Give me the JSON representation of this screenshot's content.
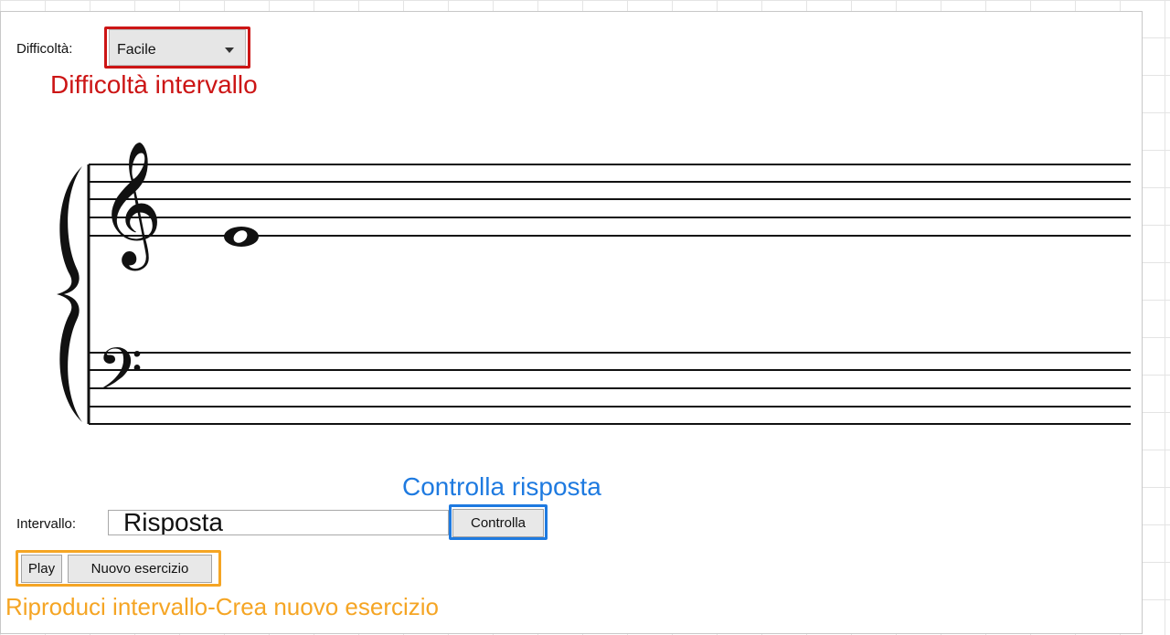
{
  "difficulty": {
    "label": "Difficoltà:",
    "selected": "Facile",
    "annotation": "Difficoltà intervallo"
  },
  "staff": {
    "treble_clef": "𝄞",
    "bass_clef": "𝄢",
    "note": "whole-note"
  },
  "answer": {
    "label": "Intervallo:",
    "value": "Risposta",
    "check_label": "Controlla",
    "check_annotation": "Controlla risposta"
  },
  "controls": {
    "play_label": "Play",
    "new_label": "Nuovo esercizio",
    "annotation": "Riproduci intervallo-Crea nuovo esercizio"
  },
  "colors": {
    "red": "#cc1515",
    "blue": "#1e7ae0",
    "orange": "#f5a524"
  }
}
